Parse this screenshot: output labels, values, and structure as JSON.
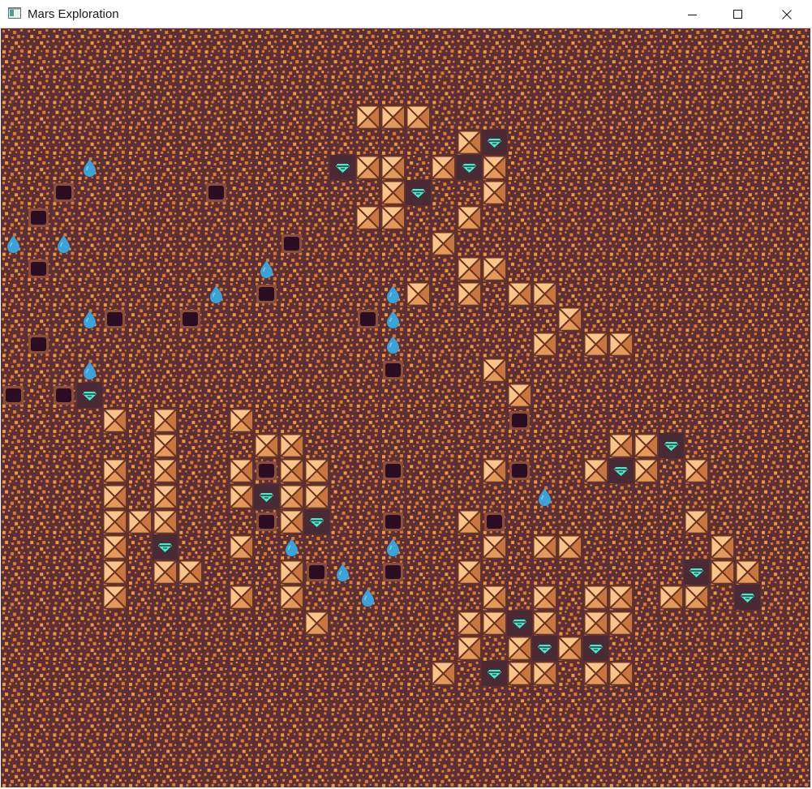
{
  "window": {
    "title": "Mars Exploration",
    "icon": "app-window-icon",
    "controls": [
      {
        "name": "minimize-button",
        "icon": "minimize-icon"
      },
      {
        "name": "maximize-button",
        "icon": "maximize-icon"
      },
      {
        "name": "close-button",
        "icon": "close-icon"
      }
    ]
  },
  "colors": {
    "ground": "#5a2f35",
    "ground_speck": "#e07a2e",
    "ground_speck_light": "#f39a3c",
    "rock_fill": "#f9c487",
    "rock_edge": "#6b3324",
    "crater": "#2a0d22",
    "crater_rim": "#8a4e3a",
    "gem": "#3ef0c9",
    "gem_bg": "#4a2a34",
    "water": "#3aa3d8"
  },
  "grid": {
    "cols": 32,
    "rows": 30
  },
  "map": {
    "rocks": [
      [
        14,
        3
      ],
      [
        15,
        3
      ],
      [
        16,
        3
      ],
      [
        18,
        4
      ],
      [
        14,
        5
      ],
      [
        15,
        5
      ],
      [
        17,
        5
      ],
      [
        19,
        5
      ],
      [
        15,
        6
      ],
      [
        19,
        6
      ],
      [
        14,
        7
      ],
      [
        15,
        7
      ],
      [
        18,
        7
      ],
      [
        17,
        8
      ],
      [
        18,
        9
      ],
      [
        19,
        9
      ],
      [
        16,
        10
      ],
      [
        18,
        10
      ],
      [
        20,
        10
      ],
      [
        21,
        10
      ],
      [
        22,
        11
      ],
      [
        21,
        12
      ],
      [
        23,
        12
      ],
      [
        24,
        12
      ],
      [
        19,
        13
      ],
      [
        20,
        14
      ],
      [
        4,
        15
      ],
      [
        6,
        15
      ],
      [
        9,
        15
      ],
      [
        6,
        16
      ],
      [
        10,
        16
      ],
      [
        11,
        16
      ],
      [
        24,
        16
      ],
      [
        25,
        16
      ],
      [
        4,
        17
      ],
      [
        6,
        17
      ],
      [
        9,
        17
      ],
      [
        11,
        17
      ],
      [
        12,
        17
      ],
      [
        19,
        17
      ],
      [
        23,
        17
      ],
      [
        25,
        17
      ],
      [
        27,
        17
      ],
      [
        4,
        18
      ],
      [
        6,
        18
      ],
      [
        9,
        18
      ],
      [
        11,
        18
      ],
      [
        12,
        18
      ],
      [
        4,
        19
      ],
      [
        5,
        19
      ],
      [
        6,
        19
      ],
      [
        11,
        19
      ],
      [
        18,
        19
      ],
      [
        27,
        19
      ],
      [
        4,
        20
      ],
      [
        9,
        20
      ],
      [
        19,
        20
      ],
      [
        21,
        20
      ],
      [
        22,
        20
      ],
      [
        28,
        20
      ],
      [
        4,
        21
      ],
      [
        6,
        21
      ],
      [
        7,
        21
      ],
      [
        11,
        21
      ],
      [
        18,
        21
      ],
      [
        28,
        21
      ],
      [
        29,
        21
      ],
      [
        4,
        22
      ],
      [
        9,
        22
      ],
      [
        11,
        22
      ],
      [
        19,
        22
      ],
      [
        21,
        22
      ],
      [
        23,
        22
      ],
      [
        24,
        22
      ],
      [
        26,
        22
      ],
      [
        27,
        22
      ],
      [
        12,
        23
      ],
      [
        18,
        23
      ],
      [
        19,
        23
      ],
      [
        21,
        23
      ],
      [
        23,
        23
      ],
      [
        24,
        23
      ],
      [
        18,
        24
      ],
      [
        20,
        24
      ],
      [
        22,
        24
      ],
      [
        17,
        25
      ],
      [
        20,
        25
      ],
      [
        21,
        25
      ],
      [
        23,
        25
      ],
      [
        24,
        25
      ]
    ],
    "craters": [
      [
        2,
        6
      ],
      [
        8,
        6
      ],
      [
        1,
        7
      ],
      [
        11,
        8
      ],
      [
        1,
        9
      ],
      [
        10,
        10
      ],
      [
        4,
        11
      ],
      [
        7,
        11
      ],
      [
        14,
        11
      ],
      [
        1,
        12
      ],
      [
        15,
        13
      ],
      [
        0,
        14
      ],
      [
        2,
        14
      ],
      [
        20,
        15
      ],
      [
        10,
        17
      ],
      [
        15,
        17
      ],
      [
        20,
        17
      ],
      [
        10,
        19
      ],
      [
        15,
        19
      ],
      [
        19,
        19
      ],
      [
        12,
        21
      ],
      [
        15,
        21
      ]
    ],
    "gems": [
      [
        19,
        4
      ],
      [
        13,
        5
      ],
      [
        18,
        5
      ],
      [
        16,
        6
      ],
      [
        3,
        14
      ],
      [
        26,
        16
      ],
      [
        24,
        17
      ],
      [
        10,
        18
      ],
      [
        12,
        19
      ],
      [
        6,
        20
      ],
      [
        27,
        21
      ],
      [
        29,
        22
      ],
      [
        20,
        23
      ],
      [
        21,
        24
      ],
      [
        23,
        24
      ],
      [
        19,
        25
      ]
    ],
    "water": [
      [
        3,
        5
      ],
      [
        0,
        8
      ],
      [
        2,
        8
      ],
      [
        10,
        9
      ],
      [
        8,
        10
      ],
      [
        15,
        10
      ],
      [
        3,
        11
      ],
      [
        15,
        11
      ],
      [
        15,
        12
      ],
      [
        3,
        13
      ],
      [
        21,
        18
      ],
      [
        11,
        20
      ],
      [
        15,
        20
      ],
      [
        13,
        21
      ],
      [
        14,
        22
      ]
    ]
  }
}
